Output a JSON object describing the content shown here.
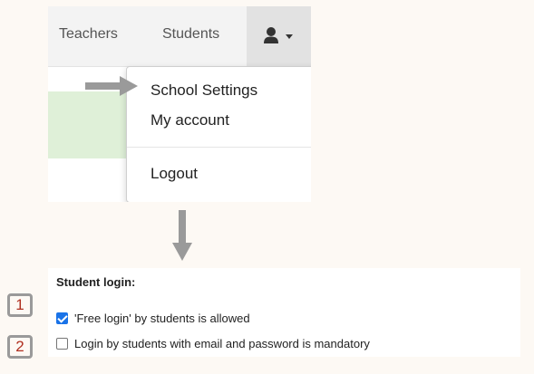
{
  "nav": {
    "teachers_label": "Teachers",
    "students_label": "Students",
    "user_icon": "user-icon",
    "caret_icon": "caret-down-icon"
  },
  "dropdown": {
    "items": [
      {
        "label": "School Settings"
      },
      {
        "label": "My account"
      },
      {
        "label": "Logout"
      }
    ]
  },
  "settings": {
    "section_title": "Student login:",
    "options": [
      {
        "label": "'Free login' by students is allowed",
        "checked": true
      },
      {
        "label": "Login by students with email and password is mandatory",
        "checked": false
      }
    ]
  },
  "annotations": {
    "badges": [
      "1",
      "2"
    ],
    "badge_color": "#b03020",
    "arrow_color": "#9a9a9a"
  },
  "colors": {
    "background": "#fdf9f4",
    "navbar": "#f3f3f3",
    "user_button": "#e2e2e2",
    "success_band": "#dff0d8",
    "checkbox_accent": "#1a73e8"
  }
}
